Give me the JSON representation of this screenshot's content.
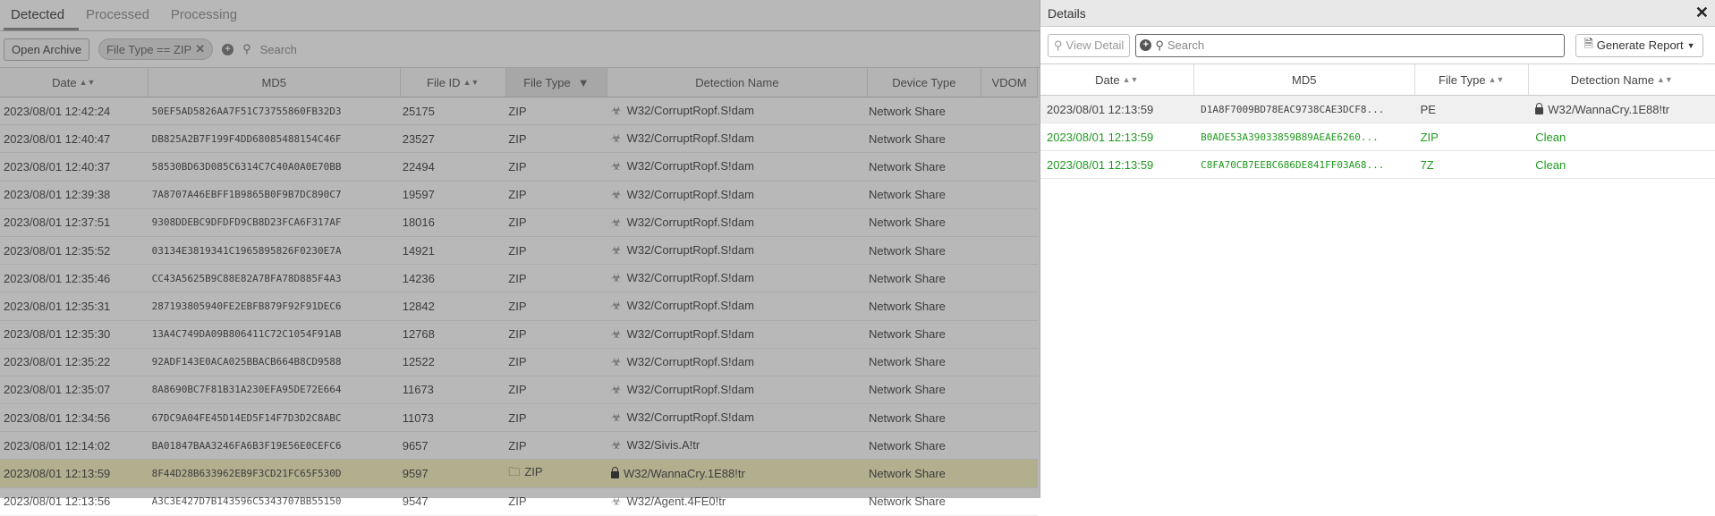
{
  "tabs": [
    "Detected",
    "Processed",
    "Processing"
  ],
  "toolbar": {
    "open_archive": "Open Archive",
    "filter": "File Type == ZIP",
    "search_placeholder": "Search"
  },
  "bg_headers": [
    "Date",
    "MD5",
    "File ID",
    "File Type",
    "Detection Name",
    "Device Type",
    "VDOM"
  ],
  "bg_rows": [
    {
      "date": "2023/08/01 12:42:24",
      "md5": "50EF5AD5826AA7F51C73755860FB32D3",
      "id": "25175",
      "type": "ZIP",
      "name": "W32/CorruptRopf.S!dam",
      "device": "Network Share"
    },
    {
      "date": "2023/08/01 12:40:47",
      "md5": "DB825A2B7F199F4DD68085488154C46F",
      "id": "23527",
      "type": "ZIP",
      "name": "W32/CorruptRopf.S!dam",
      "device": "Network Share"
    },
    {
      "date": "2023/08/01 12:40:37",
      "md5": "58530BD63D085C6314C7C40A0A0E70BB",
      "id": "22494",
      "type": "ZIP",
      "name": "W32/CorruptRopf.S!dam",
      "device": "Network Share"
    },
    {
      "date": "2023/08/01 12:39:38",
      "md5": "7A8707A46EBFF1B9865B0F9B7DC890C7",
      "id": "19597",
      "type": "ZIP",
      "name": "W32/CorruptRopf.S!dam",
      "device": "Network Share"
    },
    {
      "date": "2023/08/01 12:37:51",
      "md5": "9308DDEBC9DFDFD9CB8D23FCA6F317AF",
      "id": "18016",
      "type": "ZIP",
      "name": "W32/CorruptRopf.S!dam",
      "device": "Network Share"
    },
    {
      "date": "2023/08/01 12:35:52",
      "md5": "03134E3819341C1965895826F0230E7A",
      "id": "14921",
      "type": "ZIP",
      "name": "W32/CorruptRopf.S!dam",
      "device": "Network Share"
    },
    {
      "date": "2023/08/01 12:35:46",
      "md5": "CC43A5625B9C88E82A7BFA78D885F4A3",
      "id": "14236",
      "type": "ZIP",
      "name": "W32/CorruptRopf.S!dam",
      "device": "Network Share"
    },
    {
      "date": "2023/08/01 12:35:31",
      "md5": "287193805940FE2EBFB879F92F91DEC6",
      "id": "12842",
      "type": "ZIP",
      "name": "W32/CorruptRopf.S!dam",
      "device": "Network Share"
    },
    {
      "date": "2023/08/01 12:35:30",
      "md5": "13A4C749DA09B806411C72C1054F91AB",
      "id": "12768",
      "type": "ZIP",
      "name": "W32/CorruptRopf.S!dam",
      "device": "Network Share"
    },
    {
      "date": "2023/08/01 12:35:22",
      "md5": "92ADF143E0ACA025BBACB664B8CD9588",
      "id": "12522",
      "type": "ZIP",
      "name": "W32/CorruptRopf.S!dam",
      "device": "Network Share"
    },
    {
      "date": "2023/08/01 12:35:07",
      "md5": "8A8690BC7F81B31A230EFA95DE72E664",
      "id": "11673",
      "type": "ZIP",
      "name": "W32/CorruptRopf.S!dam",
      "device": "Network Share"
    },
    {
      "date": "2023/08/01 12:34:56",
      "md5": "67DC9A04FE45D14ED5F14F7D3D2C8ABC",
      "id": "11073",
      "type": "ZIP",
      "name": "W32/CorruptRopf.S!dam",
      "device": "Network Share"
    },
    {
      "date": "2023/08/01 12:14:02",
      "md5": "BA01847BAA3246FA6B3F19E56E0CEFC6",
      "id": "9657",
      "type": "ZIP",
      "name": "W32/Sivis.A!tr",
      "device": "Network Share"
    },
    {
      "date": "2023/08/01 12:13:59",
      "md5": "8F44D28B633962EB9F3CD21FC65F530D",
      "id": "9597",
      "type": "ZIP",
      "name": "W32/WannaCry.1E88!tr",
      "device": "Network Share",
      "highlight": true
    },
    {
      "date": "2023/08/01 12:13:56",
      "md5": "A3C3E427D7B143596C5343707BB55150",
      "id": "9547",
      "type": "ZIP",
      "name": "W32/Agent.4FE0!tr",
      "device": "Network Share"
    }
  ],
  "panel": {
    "title": "Details",
    "view_detail": "View Detail",
    "search_placeholder": "Search",
    "generate_report": "Generate Report",
    "headers": [
      "Date",
      "MD5",
      "File Type",
      "Detection Name"
    ],
    "rows": [
      {
        "date": "2023/08/01 12:13:59",
        "md5": "D1A8F7009BD78EAC9738CAE3DCF8...",
        "type": "PE",
        "name": "W32/WannaCry.1E88!tr",
        "status": "infected"
      },
      {
        "date": "2023/08/01 12:13:59",
        "md5": "B0ADE53A39033859B89AEAE6260...",
        "type": "ZIP",
        "name": "Clean",
        "status": "clean"
      },
      {
        "date": "2023/08/01 12:13:59",
        "md5": "C8FA70CB7EEBC686DE841FF03A68...",
        "type": "7Z",
        "name": "Clean",
        "status": "clean"
      }
    ]
  },
  "colors": {
    "clean": "#1f9a1f",
    "highlight": "#f6f3c4"
  }
}
